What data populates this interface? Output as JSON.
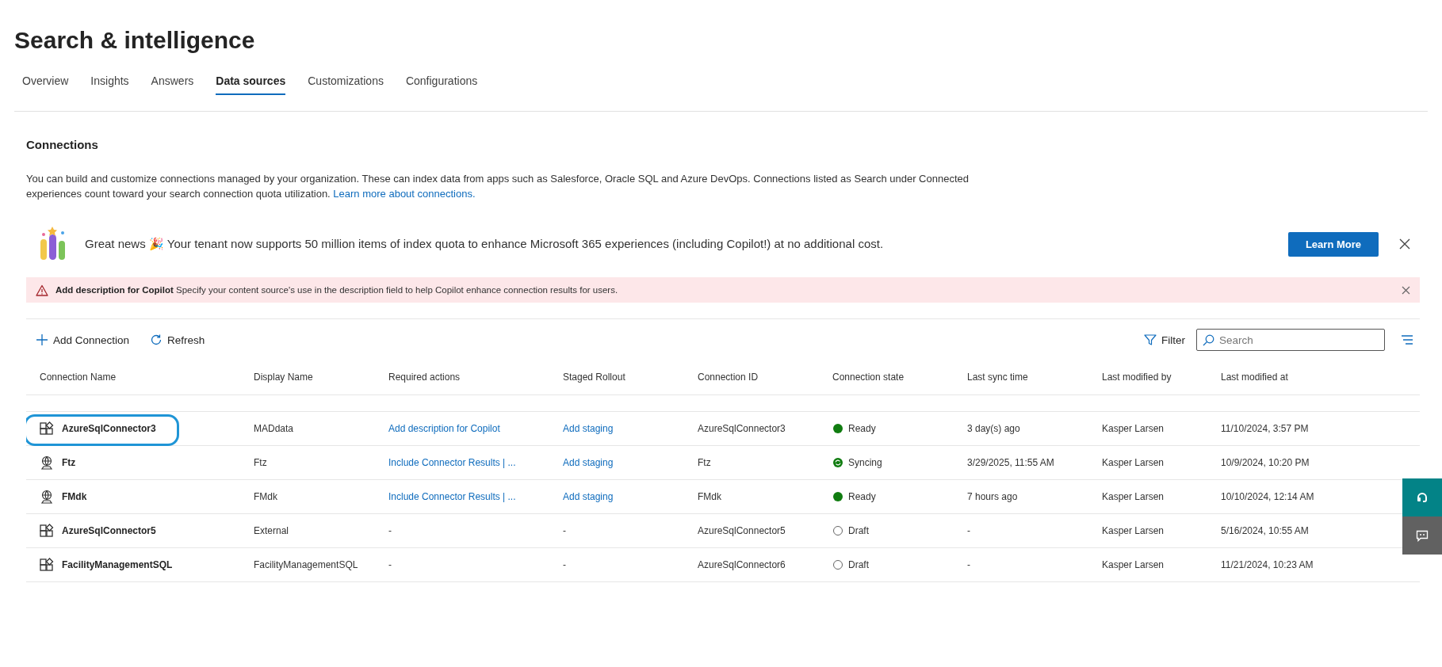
{
  "page": {
    "title": "Search & intelligence"
  },
  "tabs": [
    {
      "label": "Overview",
      "selected": false
    },
    {
      "label": "Insights",
      "selected": false
    },
    {
      "label": "Answers",
      "selected": false
    },
    {
      "label": "Data sources",
      "selected": true
    },
    {
      "label": "Customizations",
      "selected": false
    },
    {
      "label": "Configurations",
      "selected": false
    }
  ],
  "section": {
    "title": "Connections",
    "description": "You can build and customize connections managed by your organization. These can index data from apps such as Salesforce, Oracle SQL and Azure DevOps. Connections listed as Search under Connected experiences count toward your search connection quota utilization.",
    "link": "Learn more about connections."
  },
  "banner": {
    "text": "Great news 🎉 Your tenant now supports 50 million items of index quota to enhance Microsoft 365 experiences (including Copilot!) at no additional cost.",
    "button": "Learn More"
  },
  "warning": {
    "title": "Add description for Copilot",
    "text": "Specify your content source's use in the description field to help Copilot enhance connection results for users."
  },
  "toolbar": {
    "add": "Add Connection",
    "refresh": "Refresh",
    "filter": "Filter",
    "search_placeholder": "Search"
  },
  "table": {
    "columns": [
      "Connection Name",
      "Display Name",
      "Required actions",
      "Staged Rollout",
      "Connection ID",
      "Connection state",
      "Last sync time",
      "Last modified by",
      "Last modified at"
    ],
    "rows": [
      {
        "kind": "grid",
        "highlighted": true,
        "name": "AzureSqlConnector3",
        "display": "MADdata",
        "actions": "Add description for Copilot",
        "actions_link": true,
        "staged": "Add staging",
        "staged_link": true,
        "id": "AzureSqlConnector3",
        "state": {
          "kind": "ready",
          "label": "Ready"
        },
        "sync": "3 day(s) ago",
        "by": "Kasper Larsen",
        "at": "11/10/2024, 3:57 PM"
      },
      {
        "kind": "globe",
        "highlighted": false,
        "name": "Ftz",
        "display": "Ftz",
        "actions": "Include Connector Results | ...",
        "actions_link": true,
        "staged": "Add staging",
        "staged_link": true,
        "id": "Ftz",
        "state": {
          "kind": "syncing",
          "label": "Syncing"
        },
        "sync": "3/29/2025, 11:55 AM",
        "by": "Kasper Larsen",
        "at": "10/9/2024, 10:20 PM"
      },
      {
        "kind": "globe",
        "highlighted": false,
        "name": "FMdk",
        "display": "FMdk",
        "actions": "Include Connector Results | ...",
        "actions_link": true,
        "staged": "Add staging",
        "staged_link": true,
        "id": "FMdk",
        "state": {
          "kind": "ready",
          "label": "Ready"
        },
        "sync": "7 hours ago",
        "by": "Kasper Larsen",
        "at": "10/10/2024, 12:14 AM"
      },
      {
        "kind": "grid",
        "highlighted": false,
        "name": "AzureSqlConnector5",
        "display": "External",
        "actions": "-",
        "actions_link": false,
        "staged": "-",
        "staged_link": false,
        "id": "AzureSqlConnector5",
        "state": {
          "kind": "draft",
          "label": "Draft"
        },
        "sync": "-",
        "by": "Kasper Larsen",
        "at": "5/16/2024, 10:55 AM"
      },
      {
        "kind": "grid",
        "highlighted": false,
        "name": "FacilityManagementSQL",
        "display": "FacilityManagementSQL",
        "actions": "-",
        "actions_link": false,
        "staged": "-",
        "staged_link": false,
        "id": "AzureSqlConnector6",
        "state": {
          "kind": "draft",
          "label": "Draft"
        },
        "sync": "-",
        "by": "Kasper Larsen",
        "at": "11/21/2024, 10:23 AM"
      }
    ]
  }
}
